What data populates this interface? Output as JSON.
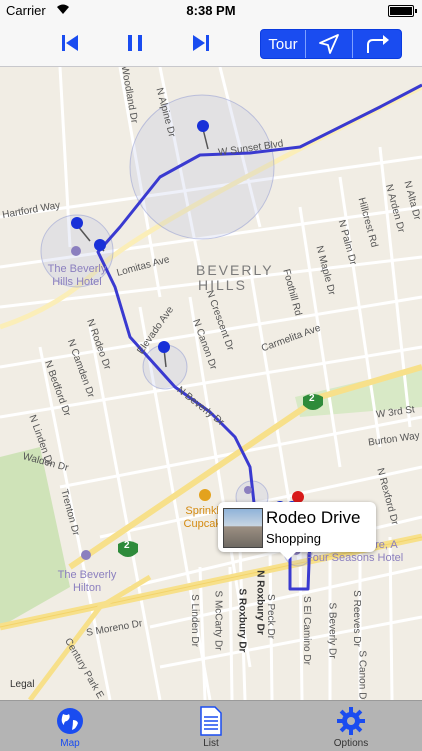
{
  "status": {
    "carrier": "Carrier",
    "time": "8:38 PM"
  },
  "toolbar": {
    "tour_label": "Tour",
    "accent": "#1a4cf0"
  },
  "map": {
    "areas": [
      "BEVERLY",
      "HILLS"
    ],
    "streets": [
      "Woodland Dr",
      "N Alpine Dr",
      "W Sunset Blvd",
      "Lomitas Ave",
      "Elevado Ave",
      "N Canon Dr",
      "N Crescent Dr",
      "N Rodeo Dr",
      "N Camden Dr",
      "N Bedford Dr",
      "N Linden Dr",
      "Walden Dr",
      "Trenton Dr",
      "N Beverly Dr",
      "Carmelita Ave",
      "Foothill Rd",
      "N Maple Dr",
      "N Palm Dr",
      "Hillcrest Rd",
      "N Arden Dr",
      "N Alta Dr",
      "N Roxbury Dr",
      "W 3rd St",
      "Burton Way",
      "N Rexford Dr",
      "S Linden Dr",
      "S McCarty Dr",
      "S Roxbury Dr",
      "S Peck Dr",
      "S El Camino Dr",
      "S Beverly Dr",
      "S Reeves Dr",
      "S Moreno Dr",
      "Century Park E",
      "S Canon Dr",
      "Hartford Way"
    ],
    "pois": {
      "beverly_hills_hotel": "The Beverly Hills Hotel",
      "sprinkles": "Sprinkles Cupcakes",
      "beverly_hilton": "The Beverly Hilton",
      "four_seasons": "Beverly Wilshire, A Four Seasons Hotel"
    },
    "route_badge": "2",
    "legal": "Legal"
  },
  "callout": {
    "title": "Rodeo Drive",
    "subtitle": "Shopping"
  },
  "tabs": [
    {
      "label": "Map",
      "icon": "globe-icon",
      "selected": true
    },
    {
      "label": "List",
      "icon": "document-icon",
      "selected": false
    },
    {
      "label": "Options",
      "icon": "gear-icon",
      "selected": false
    }
  ]
}
